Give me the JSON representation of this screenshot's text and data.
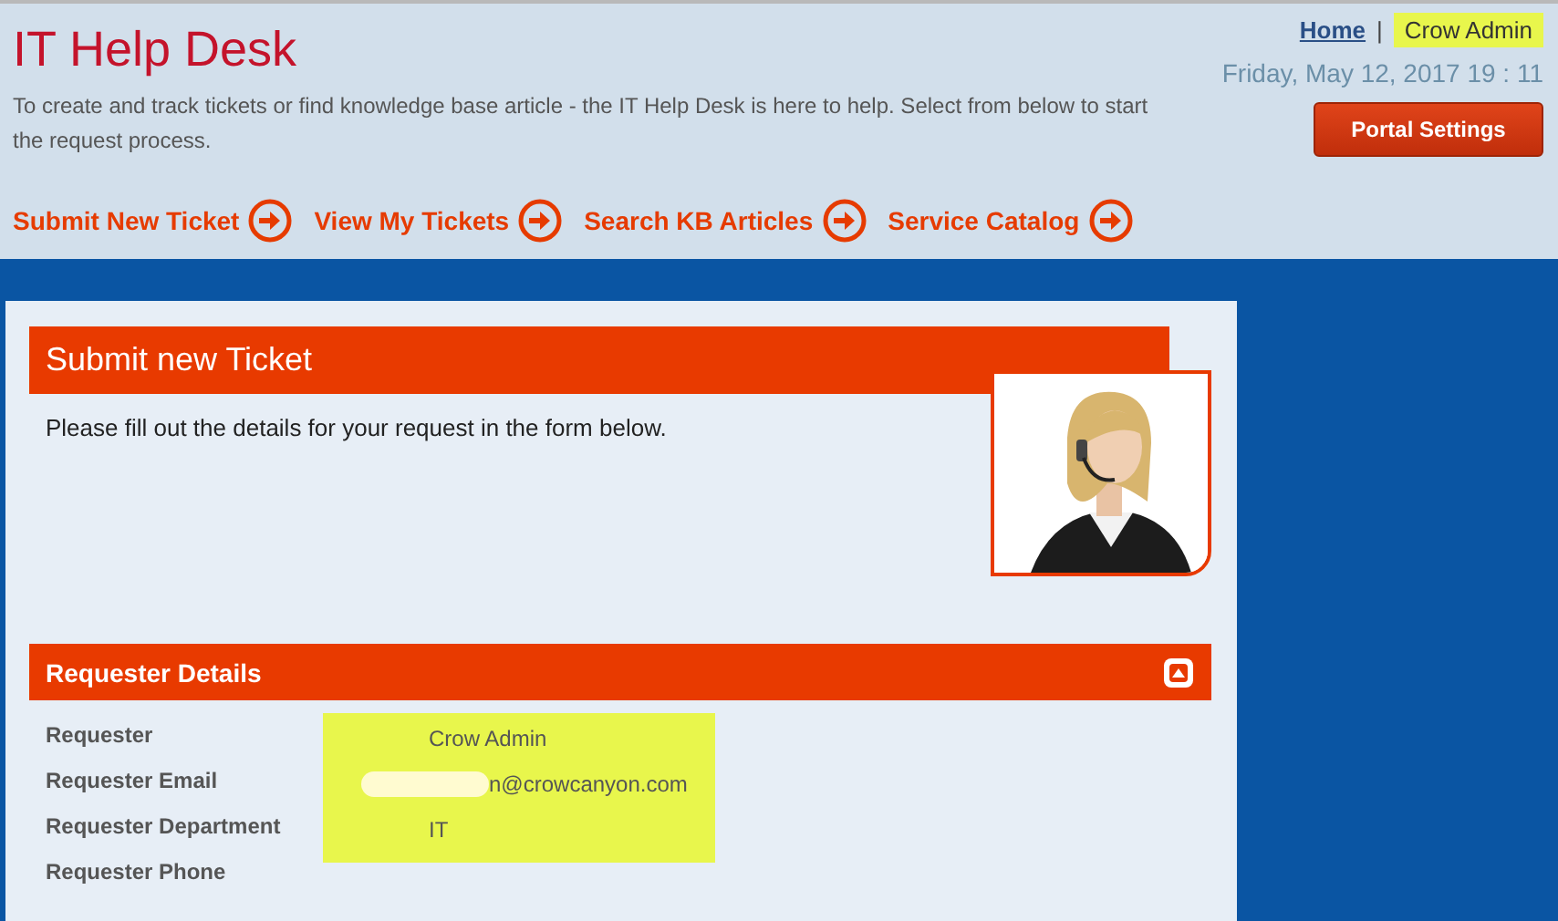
{
  "header": {
    "title": "IT Help Desk",
    "description": "To create and track tickets or find knowledge base article - the IT Help Desk is here to help. Select from below to start the request process.",
    "home_link": "Home",
    "separator": "|",
    "user": {
      "name": "Crow Admin",
      "highlighted": true
    },
    "datetime": "Friday, May 12, 2017 19 : 11",
    "settings_button": "Portal Settings"
  },
  "nav": [
    {
      "label": "Submit New Ticket"
    },
    {
      "label": "View My Tickets"
    },
    {
      "label": "Search KB Articles"
    },
    {
      "label": "Service Catalog"
    }
  ],
  "form": {
    "title": "Submit new Ticket",
    "intro": "Please fill out the details for your request in the form below.",
    "section": {
      "title": "Requester Details",
      "expanded": true,
      "values_highlighted": true,
      "fields": [
        {
          "label": "Requester",
          "value": "Crow Admin",
          "redacted": false
        },
        {
          "label": "Requester Email",
          "value": "n@crowcanyon.com",
          "redacted": true
        },
        {
          "label": "Requester Department",
          "value": "IT",
          "redacted": false
        },
        {
          "label": "Requester Phone",
          "redacted": false
        }
      ]
    }
  }
}
